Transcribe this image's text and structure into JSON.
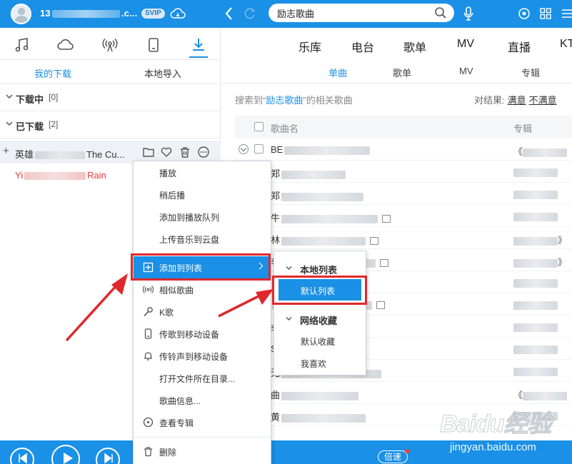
{
  "topbar": {
    "username_prefix": "13",
    "username_suffix": ".c...",
    "svip_badge": "SVIP",
    "search_value": "励志歌曲"
  },
  "left": {
    "tabs": [
      "我的下载",
      "本地导入"
    ],
    "sections": [
      {
        "title": "下载中",
        "count": "[0]"
      },
      {
        "title": "已下载",
        "count": "[2]"
      }
    ],
    "songs": [
      {
        "prefix": "英雄",
        "suffix": "The Cu..."
      },
      {
        "prefix": "Yi",
        "suffix": "Rain"
      }
    ]
  },
  "main": {
    "tabs": [
      "乐库",
      "电台",
      "歌单",
      "MV",
      "直播",
      "KT"
    ],
    "subtabs": [
      "单曲",
      "歌单",
      "MV",
      "专辑"
    ],
    "result_prefix": "搜索到“",
    "result_keyword": "励志歌曲",
    "result_suffix": "”的相关歌曲",
    "feedback_label": "对结果:",
    "feedback_good": "满意",
    "feedback_bad": "不满意",
    "col_song": "歌曲名",
    "col_album": "专辑",
    "rows": [
      {
        "lead": "BE",
        "album_prefix": "《",
        "album_suffix": ""
      },
      {
        "lead": "郑",
        "album_prefix": "",
        "album_suffix": ""
      },
      {
        "lead": "郑",
        "album_prefix": "",
        "album_suffix": ""
      },
      {
        "lead": "牛",
        "album_prefix": "",
        "album_suffix": ""
      },
      {
        "lead": "林",
        "album_prefix": "",
        "album_suffix": "》"
      },
      {
        "lead": "李",
        "album_prefix": "",
        "album_suffix": "》"
      },
      {
        "lead": "",
        "album_prefix": "",
        "album_suffix": ""
      },
      {
        "lead": "",
        "album_prefix": "",
        "album_suffix": ""
      },
      {
        "lead": "李",
        "album_prefix": "",
        "album_suffix": ""
      },
      {
        "lead": "S",
        "album_prefix": "",
        "album_suffix": ""
      },
      {
        "lead": "无",
        "album_prefix": "",
        "album_suffix": ""
      },
      {
        "lead": "曲",
        "album_prefix": "《",
        "album_suffix": ""
      },
      {
        "lead": "黄",
        "album_prefix": "",
        "album_suffix": ""
      }
    ]
  },
  "context_menu": {
    "items": [
      {
        "label": "播放"
      },
      {
        "label": "稍后播"
      },
      {
        "label": "添加到播放队列"
      },
      {
        "label": "上传音乐到云盘"
      },
      {
        "label": "添加到列表"
      },
      {
        "label": "相似歌曲"
      },
      {
        "label": "K歌"
      },
      {
        "label": "传歌到移动设备"
      },
      {
        "label": "传铃声到移动设备"
      },
      {
        "label": "打开文件所在目录..."
      },
      {
        "label": "歌曲信息..."
      },
      {
        "label": "查看专辑"
      },
      {
        "label": "删除"
      }
    ]
  },
  "submenu": {
    "group1": "本地列表",
    "item_default": "默认列表",
    "group2": "网络收藏",
    "item_fav": "默认收藏",
    "item_like": "我喜欢"
  },
  "bottombar": {
    "speed_label": "倍速"
  },
  "watermark": {
    "logo": "Baidu经验",
    "url": "jingyan.baidu.com"
  },
  "colors": {
    "brand_blue": "#1a90e6",
    "highlight_red": "#e0282c",
    "song_red": "#e03a3a"
  }
}
